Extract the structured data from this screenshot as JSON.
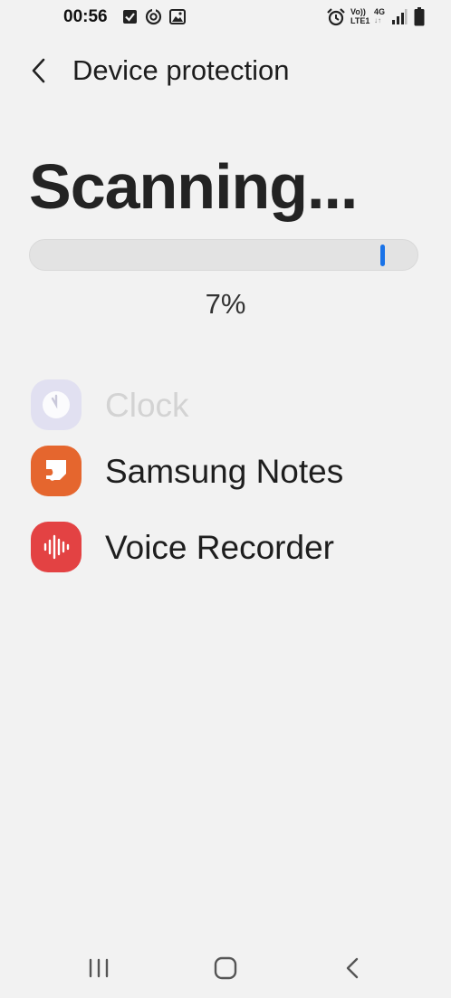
{
  "status_bar": {
    "time": "00:56",
    "left_icons": [
      "task-check-icon",
      "sync-icon",
      "gallery-icon"
    ],
    "right_icons": [
      "alarm-icon",
      "volte-icon",
      "4g-data-icon",
      "signal-icon",
      "battery-icon"
    ],
    "volte_line1": "Vo))",
    "volte_line2": "LTE1",
    "network": "4G"
  },
  "header": {
    "title": "Device protection"
  },
  "scan": {
    "title": "Scanning...",
    "progress_percent": 7,
    "progress_label": "7%",
    "accent_color": "#1a73e8"
  },
  "apps": [
    {
      "name": "Clock",
      "icon": "clock-icon",
      "color": "#e1e0f1",
      "faded": true
    },
    {
      "name": "Samsung Notes",
      "icon": "notes-icon",
      "color": "#e5662e",
      "faded": false
    },
    {
      "name": "Voice Recorder",
      "icon": "voice-recorder-icon",
      "color": "#e34243",
      "faded": false
    }
  ],
  "nav": {
    "buttons": [
      "recents-icon",
      "home-icon",
      "back-icon"
    ]
  }
}
